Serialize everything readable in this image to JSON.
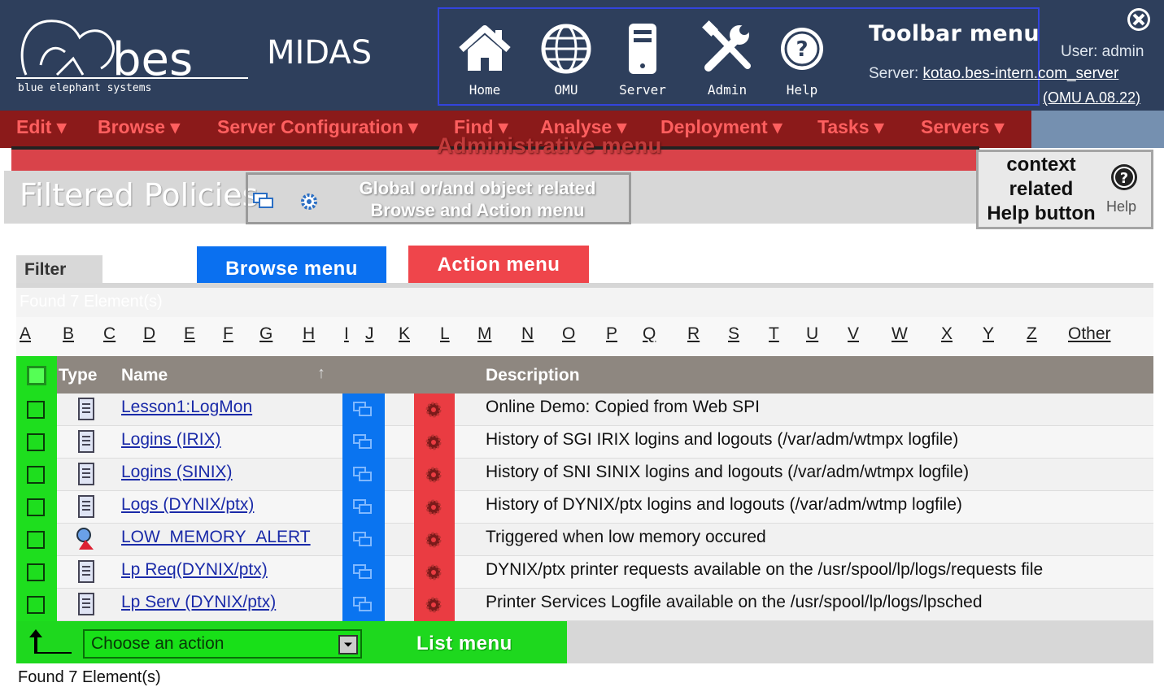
{
  "header": {
    "logo_text": "bes",
    "logo_subtext": "blue elephant systems",
    "app_name": "MIDAS",
    "toolbar_menu_label": "Toolbar menu",
    "server_prefix": "Server: ",
    "server_link": "kotao.bes-intern.com_server",
    "user_text": "User: admin",
    "omu_version": "(OMU A.08.22)"
  },
  "toolbar": [
    {
      "label": "Home",
      "icon": "home-icon"
    },
    {
      "label": "OMU",
      "icon": "globe-icon"
    },
    {
      "label": "Server",
      "icon": "server-icon"
    },
    {
      "label": "Admin",
      "icon": "tools-icon"
    },
    {
      "label": "Help",
      "icon": "help-icon"
    }
  ],
  "menubar": {
    "items": [
      "Edit ▾",
      "Browse ▾",
      "Server Configuration ▾",
      "Find ▾",
      "Analyse ▾",
      "Deployment ▾",
      "Tasks ▾",
      "Servers ▾"
    ],
    "annotation": "Administrative menu"
  },
  "page": {
    "title": "Filtered Policies",
    "global_annotation_line1": "Global or/and object related",
    "global_annotation_line2": "Browse and Action menu",
    "help_annotation_line1": "context",
    "help_annotation_line2": "related",
    "help_annotation_line3": "Help button",
    "help_small": "Help"
  },
  "filter": {
    "tab_label": "Filter",
    "browse_menu_label": "Browse menu",
    "action_menu_label": "Action menu",
    "found_top": "Found 7 Element(s)",
    "letters": [
      "A",
      "B",
      "C",
      "D",
      "E",
      "F",
      "G",
      "H",
      "I",
      "J",
      "K",
      "L",
      "M",
      "N",
      "O",
      "P",
      "Q",
      "R",
      "S",
      "T",
      "U",
      "V",
      "W",
      "X",
      "Y",
      "Z",
      "Other"
    ]
  },
  "table": {
    "headers": {
      "type": "Type",
      "name": "Name",
      "description": "Description"
    },
    "rows": [
      {
        "name": "Lesson1:LogMon",
        "description": "Online Demo: Copied from Web SPI",
        "icon": "document-icon"
      },
      {
        "name": "Logins (IRIX)",
        "description": "History of SGI IRIX logins and logouts (/var/adm/wtmpx logfile)",
        "icon": "document-icon"
      },
      {
        "name": "Logins (SINIX)",
        "description": "History of SNI SINIX logins and logouts (/var/adm/wtmpx logfile)",
        "icon": "document-icon"
      },
      {
        "name": "Logs (DYNIX/ptx)",
        "description": "History of DYNIX/ptx logins and logouts (/var/adm/wtmp logfile)",
        "icon": "document-icon"
      },
      {
        "name": "LOW_MEMORY_ALERT",
        "description": "Triggered when low memory occured",
        "icon": "monitor-icon"
      },
      {
        "name": "Lp Req(DYNIX/ptx)",
        "description": "DYNIX/ptx printer requests available on the /usr/spool/lp/logs/requests file",
        "icon": "document-icon"
      },
      {
        "name": "Lp Serv (DYNIX/ptx)",
        "description": "Printer Services Logfile available on the /usr/spool/lp/logs/lpsched",
        "icon": "document-icon"
      }
    ]
  },
  "footer": {
    "action_select_value": "Choose an action",
    "list_menu_label": "List menu",
    "found_bottom": "Found 7 Element(s)"
  },
  "colors": {
    "header_bg": "#2e3f5c",
    "menubar_bg": "#8b1a1a",
    "browse_blue": "#0a70f0",
    "action_red": "#ef454b",
    "list_green": "#1ede1e"
  }
}
